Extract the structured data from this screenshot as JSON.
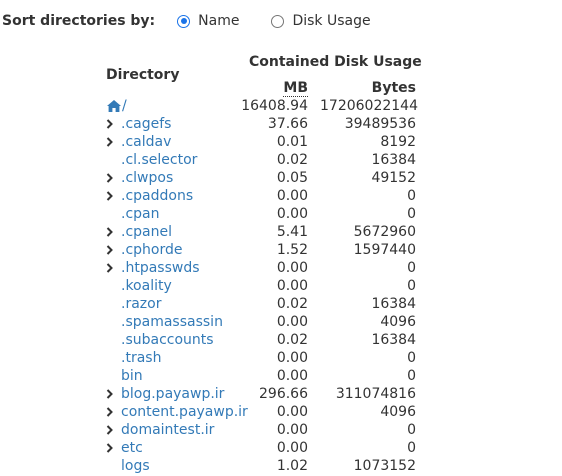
{
  "sort": {
    "label": "Sort directories by:",
    "options": [
      {
        "label": "Name",
        "checked": true
      },
      {
        "label": "Disk Usage",
        "checked": false
      }
    ]
  },
  "headers": {
    "directory": "Directory",
    "contained": "Contained Disk Usage",
    "mb": "MB",
    "bytes": "Bytes"
  },
  "root": {
    "icon": "home-icon",
    "label": "/",
    "mb": "16408.94",
    "bytes": "17206022144"
  },
  "rows": [
    {
      "name": ".cagefs",
      "mb": "37.66",
      "bytes": "39489536",
      "expandable": true
    },
    {
      "name": ".caldav",
      "mb": "0.01",
      "bytes": "8192",
      "expandable": true
    },
    {
      "name": ".cl.selector",
      "mb": "0.02",
      "bytes": "16384",
      "expandable": false
    },
    {
      "name": ".clwpos",
      "mb": "0.05",
      "bytes": "49152",
      "expandable": true
    },
    {
      "name": ".cpaddons",
      "mb": "0.00",
      "bytes": "0",
      "expandable": true
    },
    {
      "name": ".cpan",
      "mb": "0.00",
      "bytes": "0",
      "expandable": false
    },
    {
      "name": ".cpanel",
      "mb": "5.41",
      "bytes": "5672960",
      "expandable": true
    },
    {
      "name": ".cphorde",
      "mb": "1.52",
      "bytes": "1597440",
      "expandable": true
    },
    {
      "name": ".htpasswds",
      "mb": "0.00",
      "bytes": "0",
      "expandable": true
    },
    {
      "name": ".koality",
      "mb": "0.00",
      "bytes": "0",
      "expandable": false
    },
    {
      "name": ".razor",
      "mb": "0.02",
      "bytes": "16384",
      "expandable": false
    },
    {
      "name": ".spamassassin",
      "mb": "0.00",
      "bytes": "4096",
      "expandable": false
    },
    {
      "name": ".subaccounts",
      "mb": "0.02",
      "bytes": "16384",
      "expandable": false
    },
    {
      "name": ".trash",
      "mb": "0.00",
      "bytes": "0",
      "expandable": false
    },
    {
      "name": "bin",
      "mb": "0.00",
      "bytes": "0",
      "expandable": false
    },
    {
      "name": "blog.payawp.ir",
      "mb": "296.66",
      "bytes": "311074816",
      "expandable": true
    },
    {
      "name": "content.payawp.ir",
      "mb": "0.00",
      "bytes": "4096",
      "expandable": true
    },
    {
      "name": "domaintest.ir",
      "mb": "0.00",
      "bytes": "0",
      "expandable": true
    },
    {
      "name": "etc",
      "mb": "0.00",
      "bytes": "0",
      "expandable": true
    },
    {
      "name": "logs",
      "mb": "1.02",
      "bytes": "1073152",
      "expandable": false
    }
  ],
  "colors": {
    "link": "#337ab7",
    "text": "#333333",
    "radio_accent": "#1a73e8"
  }
}
